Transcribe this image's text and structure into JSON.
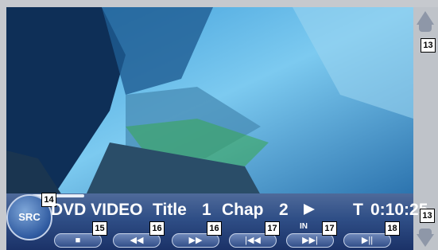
{
  "source_button": {
    "label": "SRC"
  },
  "status": {
    "mode": "DVD VIDEO",
    "title_label": "Title",
    "title_value": "1",
    "chap_label": "Chap",
    "chap_value": "2",
    "time_label": "T",
    "time_value": "0:10:25"
  },
  "in_label": "IN",
  "controls": [
    {
      "name": "stop",
      "glyph": "■"
    },
    {
      "name": "rewind",
      "glyph": "◀◀"
    },
    {
      "name": "fast-forward",
      "glyph": "▶▶"
    },
    {
      "name": "previous",
      "glyph": "|◀◀"
    },
    {
      "name": "next",
      "glyph": "▶▶|"
    },
    {
      "name": "play-pause",
      "glyph": "▶||"
    }
  ],
  "callouts": {
    "scroll_up": "13",
    "scroll_down": "13",
    "src": "14",
    "stop": "15",
    "rewind": "16",
    "fast_forward": "16",
    "previous": "17",
    "next": "17",
    "play_pause": "18"
  }
}
